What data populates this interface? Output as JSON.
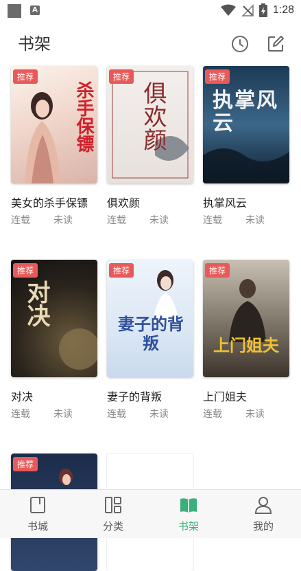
{
  "status_bar": {
    "time": "1:28",
    "notification_icon": "A"
  },
  "header": {
    "title": "书架"
  },
  "books": [
    {
      "title": "美女的杀手保镖",
      "cover_title": "杀手保镖",
      "badge": "推荐",
      "status": "连载",
      "read_state": "未读"
    },
    {
      "title": "俱欢颜",
      "cover_title": "俱欢颜",
      "badge": "推荐",
      "status": "连载",
      "read_state": "未读"
    },
    {
      "title": "执掌风云",
      "cover_title": "执掌风云",
      "badge": "推荐",
      "status": "连载",
      "read_state": "未读"
    },
    {
      "title": "对决",
      "cover_title": "对决",
      "badge": "推荐",
      "status": "连载",
      "read_state": "未读"
    },
    {
      "title": "妻子的背叛",
      "cover_title": "妻子的背叛",
      "badge": "推荐",
      "status": "连载",
      "read_state": "未读"
    },
    {
      "title": "上门姐夫",
      "cover_title": "上门姐夫",
      "badge": "推荐",
      "status": "连载",
      "read_state": "未读"
    },
    {
      "title": "",
      "cover_title": "",
      "badge": "推荐",
      "status": "",
      "read_state": ""
    }
  ],
  "bottom_nav": {
    "items": [
      {
        "label": "书城",
        "icon": "book-icon"
      },
      {
        "label": "分类",
        "icon": "category-icon"
      },
      {
        "label": "书架",
        "icon": "bookshelf-icon"
      },
      {
        "label": "我的",
        "icon": "profile-icon"
      }
    ],
    "active_index": 2
  },
  "colors": {
    "accent": "#3bb07a",
    "badge": "#e85a5a"
  }
}
